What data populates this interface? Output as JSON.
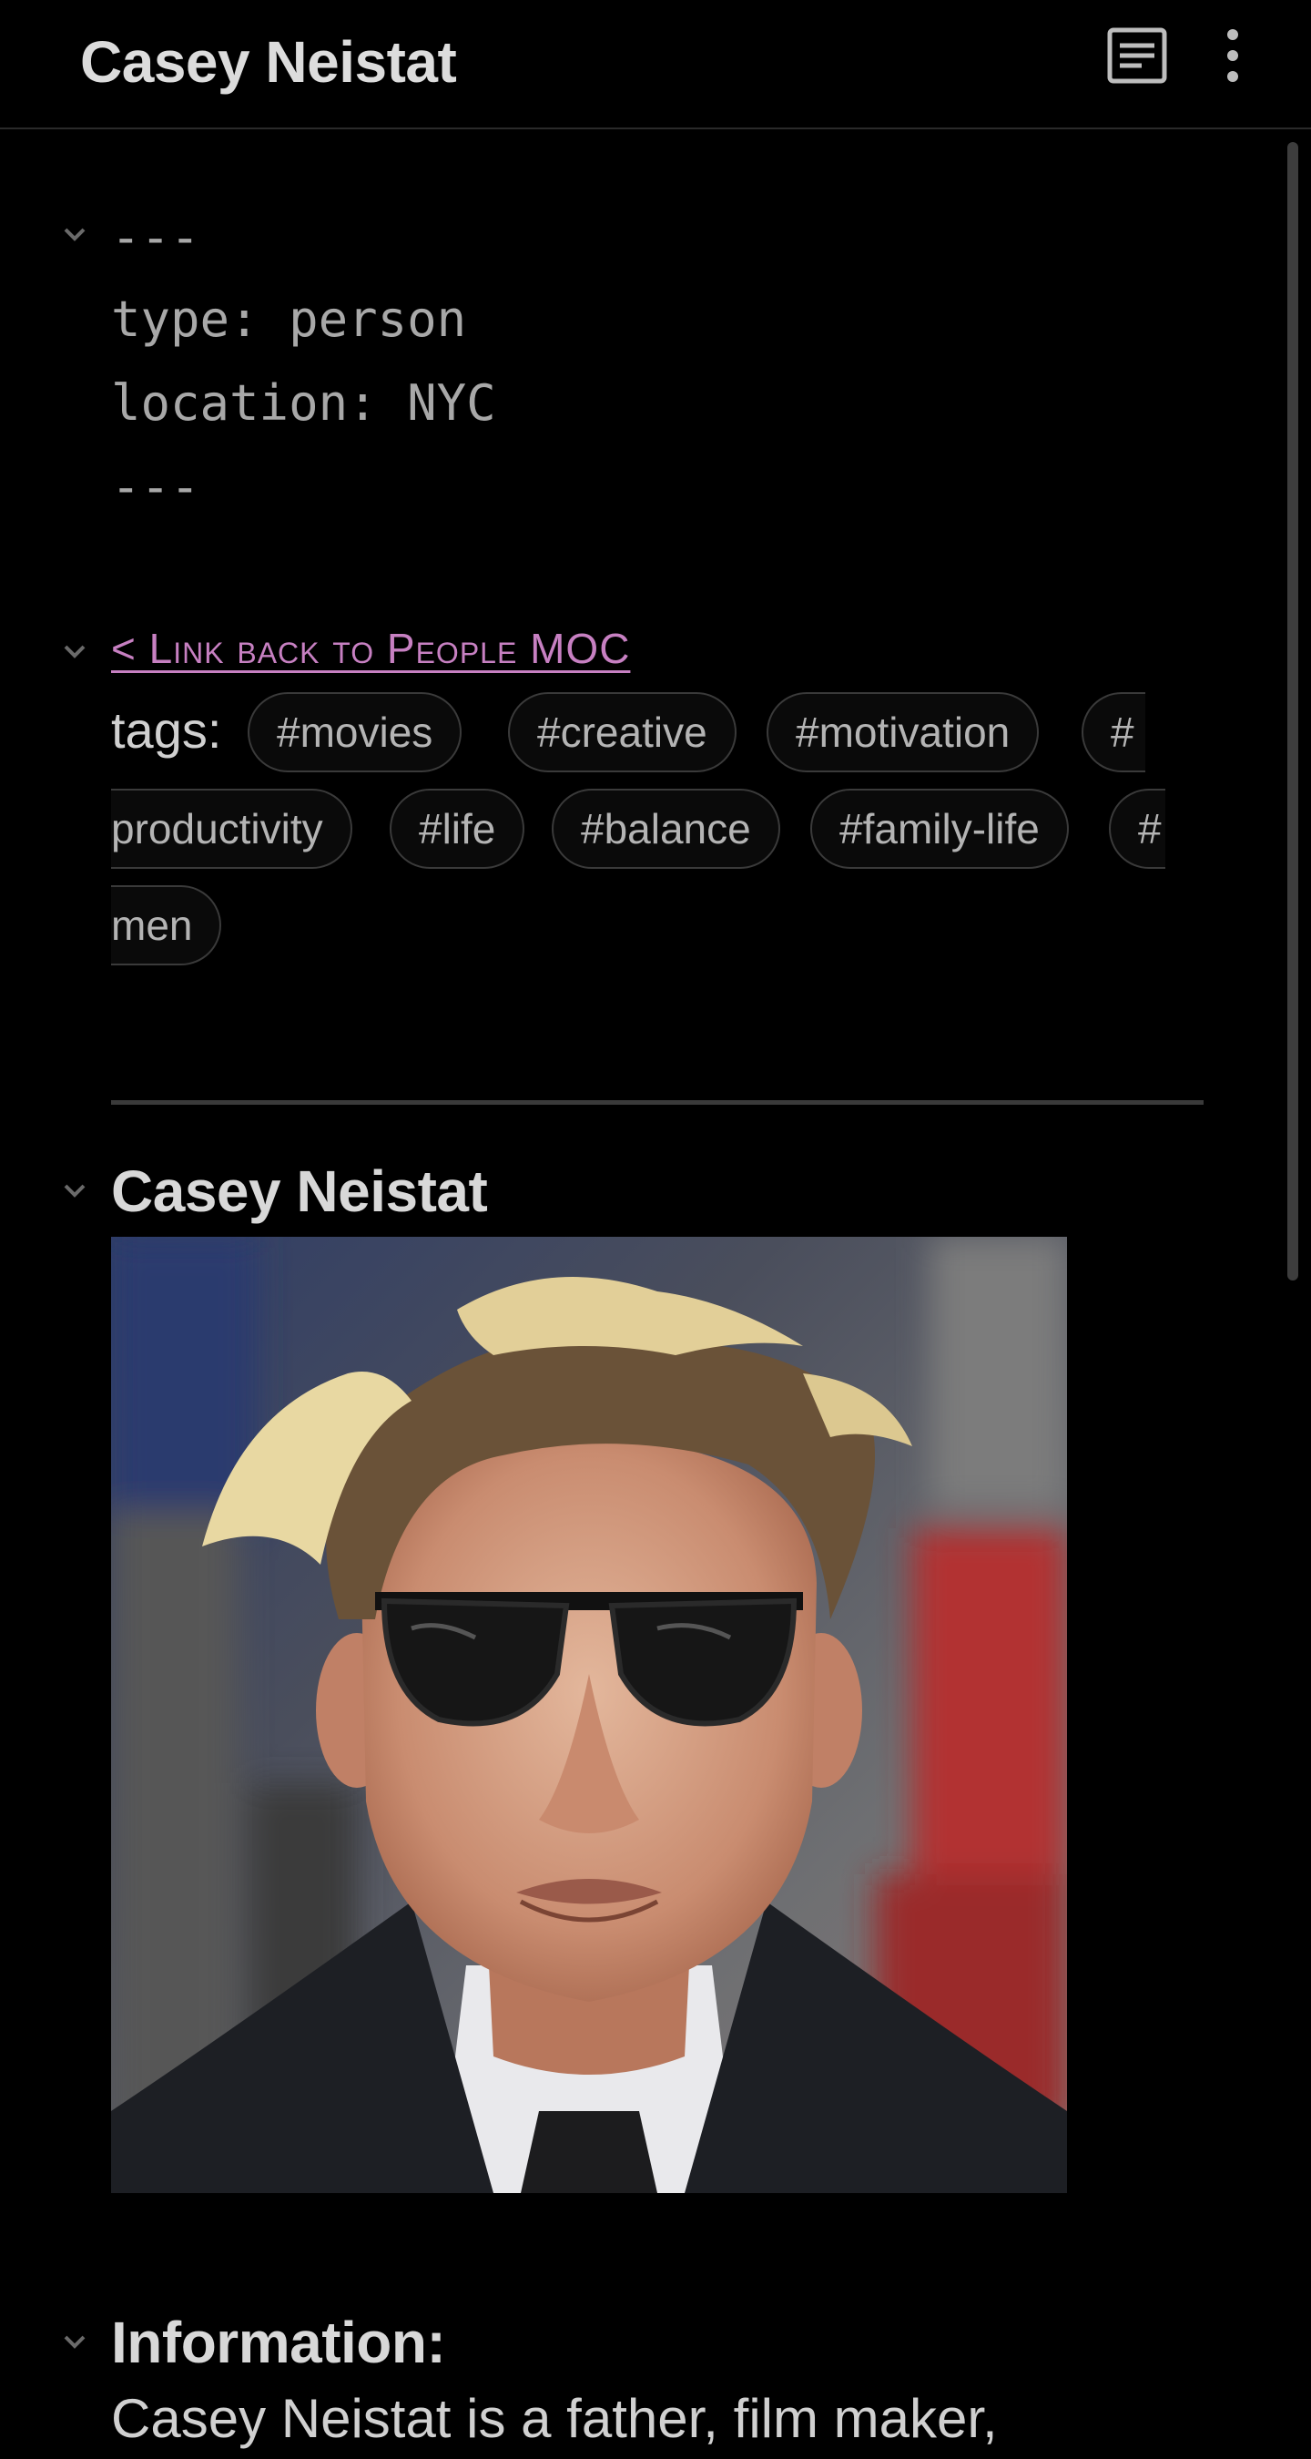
{
  "header": {
    "title": "Casey Neistat",
    "reader_icon": "reading-view-icon",
    "more_icon": "more-vertical-icon"
  },
  "frontmatter": {
    "open": "---",
    "lines": [
      "type: person",
      "location: NYC"
    ],
    "close": "---"
  },
  "link_back": "< Link back to People MOC",
  "tags": {
    "label": "tags:",
    "items": [
      "#movies",
      "#creative",
      "#motivation",
      "#",
      "productivity",
      "#life",
      "#balance",
      "#family-life",
      "#",
      "men"
    ]
  },
  "section": {
    "heading": "Casey Neistat",
    "image_alt": "Casey Neistat"
  },
  "information": {
    "heading": "Information:",
    "text": "Casey Neistat is a father, film maker,"
  },
  "colors": {
    "background": "#000000",
    "link": "#c780c2",
    "text": "#d8d8d8",
    "muted": "#a8a8a8"
  }
}
